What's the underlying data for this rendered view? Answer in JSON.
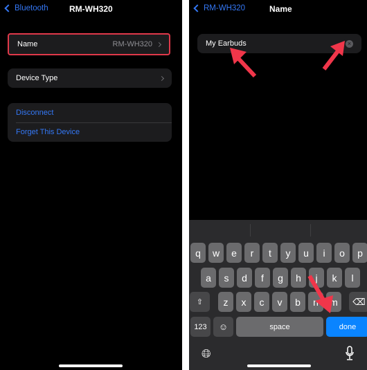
{
  "left": {
    "nav": {
      "back_label": "Bluetooth",
      "title": "RM-WH320"
    },
    "name_row": {
      "label": "Name",
      "value": "RM-WH320"
    },
    "device_type_row": {
      "label": "Device Type"
    },
    "actions": [
      "Disconnect",
      "Forget This Device"
    ]
  },
  "right": {
    "nav": {
      "back_label": "RM-WH320",
      "title": "Name"
    },
    "name_field": {
      "value": "My Earbuds"
    },
    "keyboard": {
      "row1": [
        "q",
        "w",
        "e",
        "r",
        "t",
        "y",
        "u",
        "i",
        "o",
        "p"
      ],
      "row2": [
        "a",
        "s",
        "d",
        "f",
        "g",
        "h",
        "j",
        "k",
        "l"
      ],
      "row3": [
        "z",
        "x",
        "c",
        "v",
        "b",
        "n",
        "m"
      ],
      "numbers_label": "123",
      "space_label": "space",
      "done_label": "done"
    }
  },
  "colors": {
    "accent": "#3478f6",
    "highlight": "#e0394a",
    "done": "#0a84ff"
  }
}
